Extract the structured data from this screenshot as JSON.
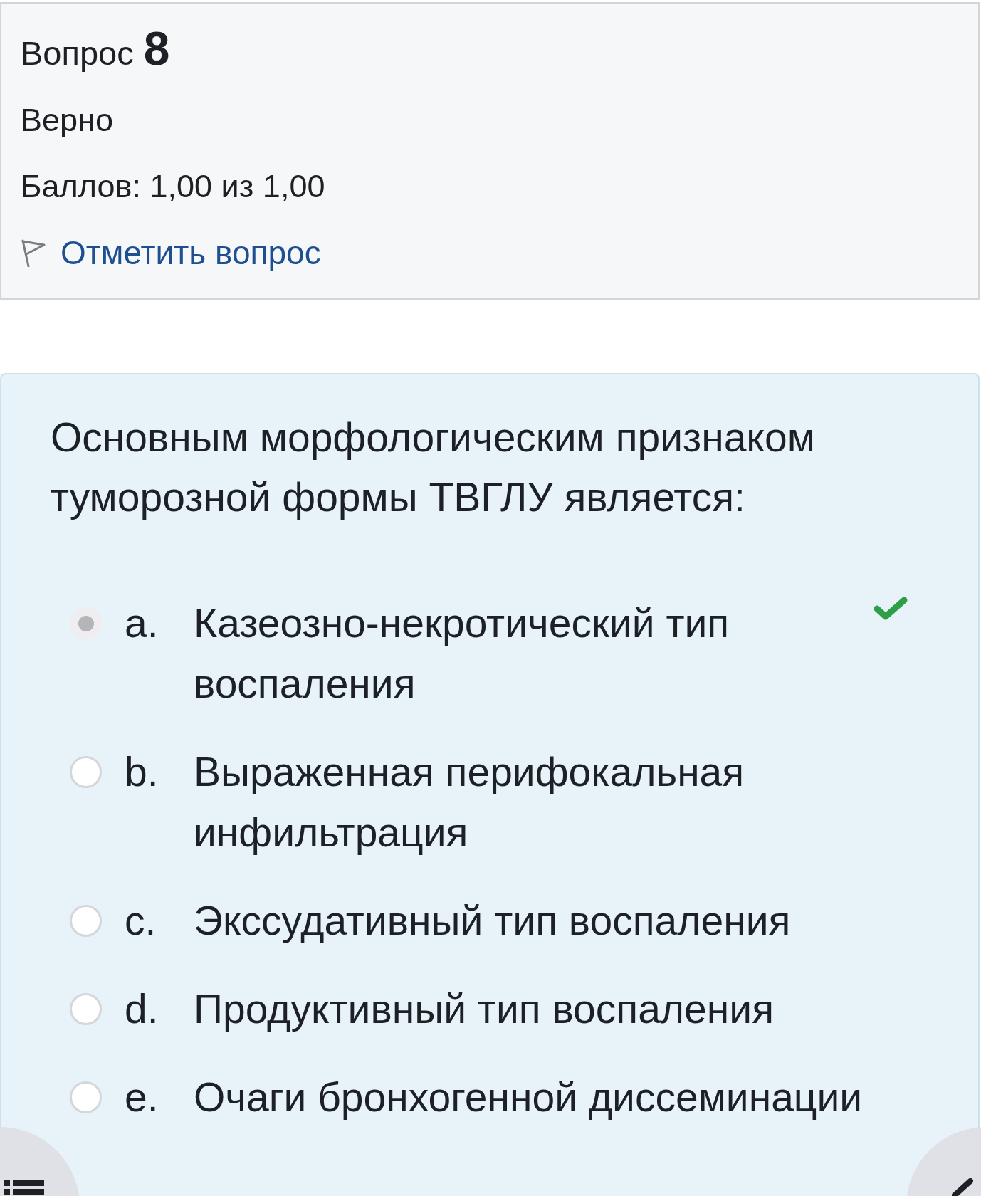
{
  "question_info": {
    "label": "Вопрос",
    "number": "8",
    "state": "Верно",
    "grade": "Баллов: 1,00 из 1,00",
    "flag_link": "Отметить вопрос"
  },
  "question": {
    "text": "Основным морфологическим признаком туморозной формы ТВГЛУ является:",
    "options": [
      {
        "letter": "a.",
        "text": "Казеозно-некротический тип воспаления",
        "selected": true,
        "correct": true
      },
      {
        "letter": "b.",
        "text": "Выраженная перифокальная инфильтрация",
        "selected": false,
        "correct": false
      },
      {
        "letter": "c.",
        "text": "Экссудативный тип воспаления",
        "selected": false,
        "correct": false
      },
      {
        "letter": "d.",
        "text": "Продуктивный тип воспаления",
        "selected": false,
        "correct": false
      },
      {
        "letter": "e.",
        "text": "Очаги бронхогенной диссеминации",
        "selected": false,
        "correct": false
      }
    ]
  }
}
